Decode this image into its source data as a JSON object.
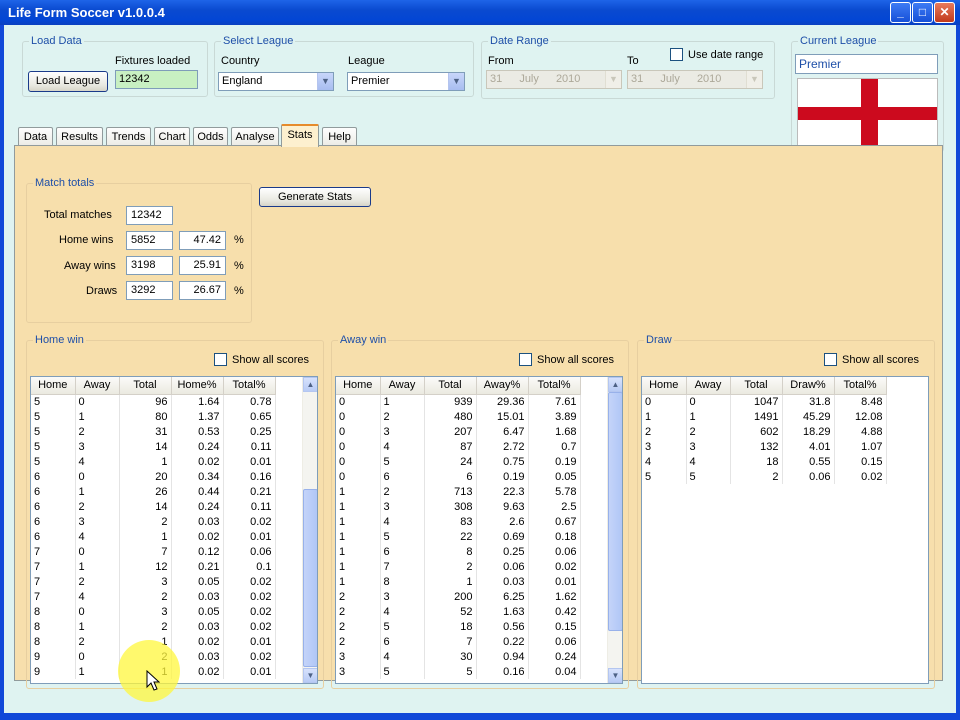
{
  "window": {
    "title": "Life Form Soccer v1.0.0.4",
    "min_icon": "minimize-icon",
    "max_icon": "maximize-icon",
    "close_icon": "close-icon",
    "min_glyph": "_",
    "max_glyph": "□",
    "close_glyph": "✕"
  },
  "load_data": {
    "title": "Load Data",
    "button": "Load League",
    "fixtures_label": "Fixtures loaded",
    "fixtures_value": "12342"
  },
  "select_league": {
    "title": "Select League",
    "country_label": "Country",
    "country_value": "England",
    "league_label": "League",
    "league_value": "Premier"
  },
  "date_range": {
    "title": "Date Range",
    "use_label": "Use date range",
    "from_label": "From",
    "to_label": "To",
    "from": {
      "day": "31",
      "month": "July",
      "year": "2010"
    },
    "to": {
      "day": "31",
      "month": "July",
      "year": "2010"
    }
  },
  "current_league": {
    "title": "Current League",
    "value": "Premier",
    "flag": "england-flag",
    "flag_colors": {
      "field": "#ffffff",
      "cross": "#cc0a1e"
    }
  },
  "tabs": [
    "Data",
    "Results",
    "Trends",
    "Chart",
    "Odds",
    "Analyse",
    "Stats",
    "Help"
  ],
  "active_tab": "Stats",
  "match_totals": {
    "title": "Match totals",
    "total_label": "Total matches",
    "total": "12342",
    "home_label": "Home wins",
    "home": "5852",
    "home_pct": "47.42",
    "away_label": "Away wins",
    "away": "3198",
    "away_pct": "25.91",
    "draws_label": "Draws",
    "draws": "3292",
    "draws_pct": "26.67",
    "pct_sign": "%"
  },
  "generate_button": "Generate Stats",
  "show_all_label": "Show all scores",
  "home_win": {
    "title": "Home win",
    "columns": [
      "Home",
      "Away",
      "Total",
      "Home%",
      "Total%"
    ],
    "rows": [
      [
        "5",
        "0",
        "96",
        "1.64",
        "0.78"
      ],
      [
        "5",
        "1",
        "80",
        "1.37",
        "0.65"
      ],
      [
        "5",
        "2",
        "31",
        "0.53",
        "0.25"
      ],
      [
        "5",
        "3",
        "14",
        "0.24",
        "0.11"
      ],
      [
        "5",
        "4",
        "1",
        "0.02",
        "0.01"
      ],
      [
        "6",
        "0",
        "20",
        "0.34",
        "0.16"
      ],
      [
        "6",
        "1",
        "26",
        "0.44",
        "0.21"
      ],
      [
        "6",
        "2",
        "14",
        "0.24",
        "0.11"
      ],
      [
        "6",
        "3",
        "2",
        "0.03",
        "0.02"
      ],
      [
        "6",
        "4",
        "1",
        "0.02",
        "0.01"
      ],
      [
        "7",
        "0",
        "7",
        "0.12",
        "0.06"
      ],
      [
        "7",
        "1",
        "12",
        "0.21",
        "0.1"
      ],
      [
        "7",
        "2",
        "3",
        "0.05",
        "0.02"
      ],
      [
        "7",
        "4",
        "2",
        "0.03",
        "0.02"
      ],
      [
        "8",
        "0",
        "3",
        "0.05",
        "0.02"
      ],
      [
        "8",
        "1",
        "2",
        "0.03",
        "0.02"
      ],
      [
        "8",
        "2",
        "1",
        "0.02",
        "0.01"
      ],
      [
        "9",
        "0",
        "2",
        "0.03",
        "0.02"
      ],
      [
        "9",
        "1",
        "1",
        "0.02",
        "0.01"
      ]
    ]
  },
  "away_win": {
    "title": "Away win",
    "columns": [
      "Home",
      "Away",
      "Total",
      "Away%",
      "Total%"
    ],
    "rows": [
      [
        "0",
        "1",
        "939",
        "29.36",
        "7.61"
      ],
      [
        "0",
        "2",
        "480",
        "15.01",
        "3.89"
      ],
      [
        "0",
        "3",
        "207",
        "6.47",
        "1.68"
      ],
      [
        "0",
        "4",
        "87",
        "2.72",
        "0.7"
      ],
      [
        "0",
        "5",
        "24",
        "0.75",
        "0.19"
      ],
      [
        "0",
        "6",
        "6",
        "0.19",
        "0.05"
      ],
      [
        "1",
        "2",
        "713",
        "22.3",
        "5.78"
      ],
      [
        "1",
        "3",
        "308",
        "9.63",
        "2.5"
      ],
      [
        "1",
        "4",
        "83",
        "2.6",
        "0.67"
      ],
      [
        "1",
        "5",
        "22",
        "0.69",
        "0.18"
      ],
      [
        "1",
        "6",
        "8",
        "0.25",
        "0.06"
      ],
      [
        "1",
        "7",
        "2",
        "0.06",
        "0.02"
      ],
      [
        "1",
        "8",
        "1",
        "0.03",
        "0.01"
      ],
      [
        "2",
        "3",
        "200",
        "6.25",
        "1.62"
      ],
      [
        "2",
        "4",
        "52",
        "1.63",
        "0.42"
      ],
      [
        "2",
        "5",
        "18",
        "0.56",
        "0.15"
      ],
      [
        "2",
        "6",
        "7",
        "0.22",
        "0.06"
      ],
      [
        "3",
        "4",
        "30",
        "0.94",
        "0.24"
      ],
      [
        "3",
        "5",
        "5",
        "0.16",
        "0.04"
      ]
    ]
  },
  "draw": {
    "title": "Draw",
    "columns": [
      "Home",
      "Away",
      "Total",
      "Draw%",
      "Total%"
    ],
    "rows": [
      [
        "0",
        "0",
        "1047",
        "31.8",
        "8.48"
      ],
      [
        "1",
        "1",
        "1491",
        "45.29",
        "12.08"
      ],
      [
        "2",
        "2",
        "602",
        "18.29",
        "4.88"
      ],
      [
        "3",
        "3",
        "132",
        "4.01",
        "1.07"
      ],
      [
        "4",
        "4",
        "18",
        "0.55",
        "0.15"
      ],
      [
        "5",
        "5",
        "2",
        "0.06",
        "0.02"
      ]
    ]
  }
}
